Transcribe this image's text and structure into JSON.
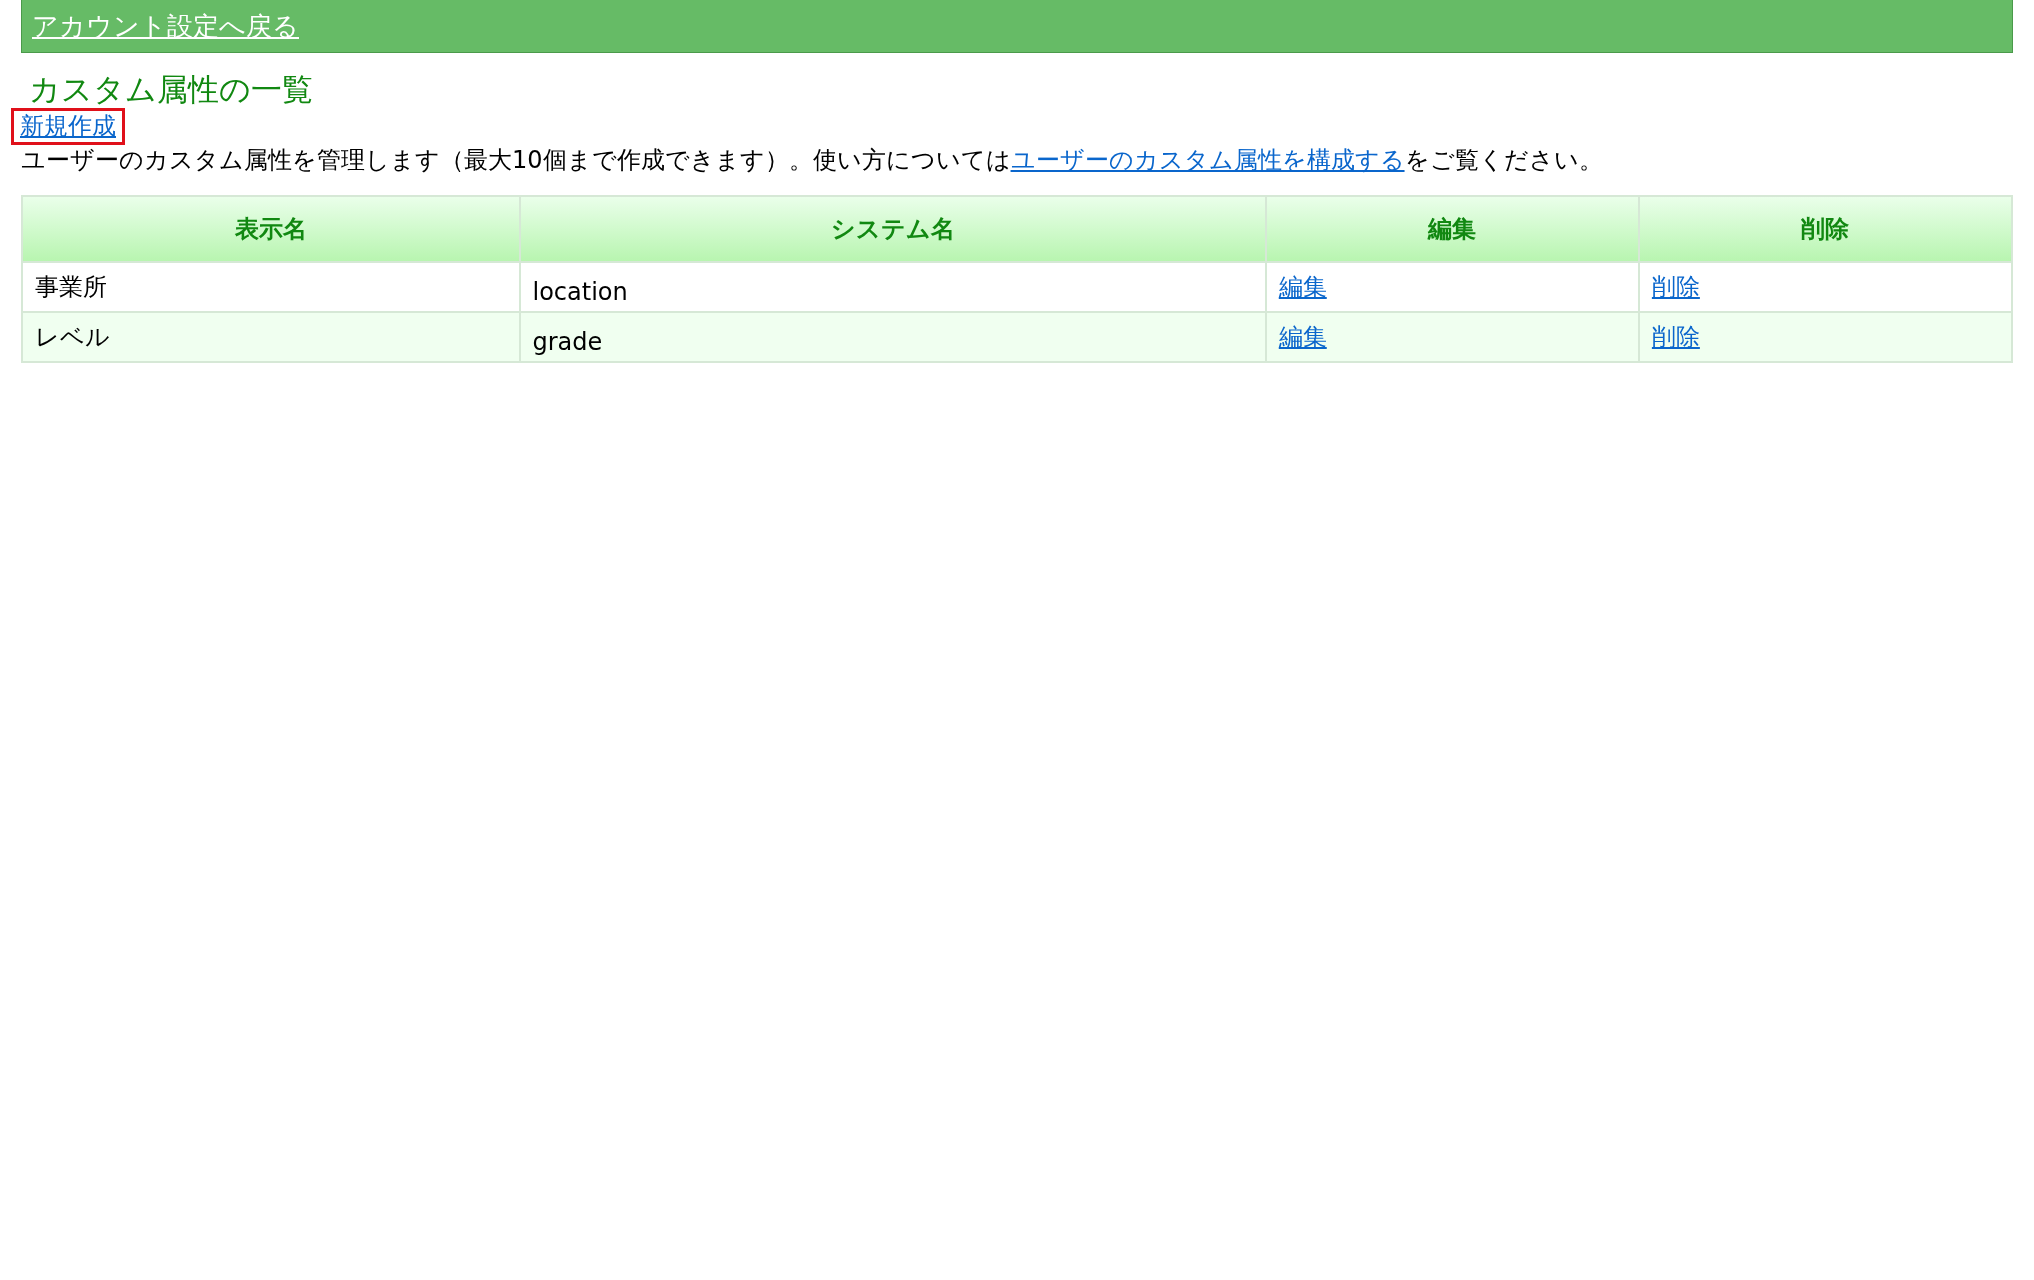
{
  "back_link": {
    "label": "アカウント設定へ戻る"
  },
  "title": "カスタム属性の一覧",
  "create_link": {
    "label": "新規作成",
    "highlighted": true
  },
  "description": {
    "before": "ユーザーのカスタム属性を管理します（最大10個まで作成できます）。使い方については",
    "link": "ユーザーのカスタム属性を構成する",
    "after": "をご覧ください。"
  },
  "table": {
    "columns": [
      "表示名",
      "システム名",
      "編集",
      "削除"
    ],
    "rows": [
      {
        "display_name": "事業所",
        "system_name": "location",
        "edit": "編集",
        "delete": "削除"
      },
      {
        "display_name": "レベル",
        "system_name": "grade",
        "edit": "編集",
        "delete": "削除"
      }
    ]
  }
}
